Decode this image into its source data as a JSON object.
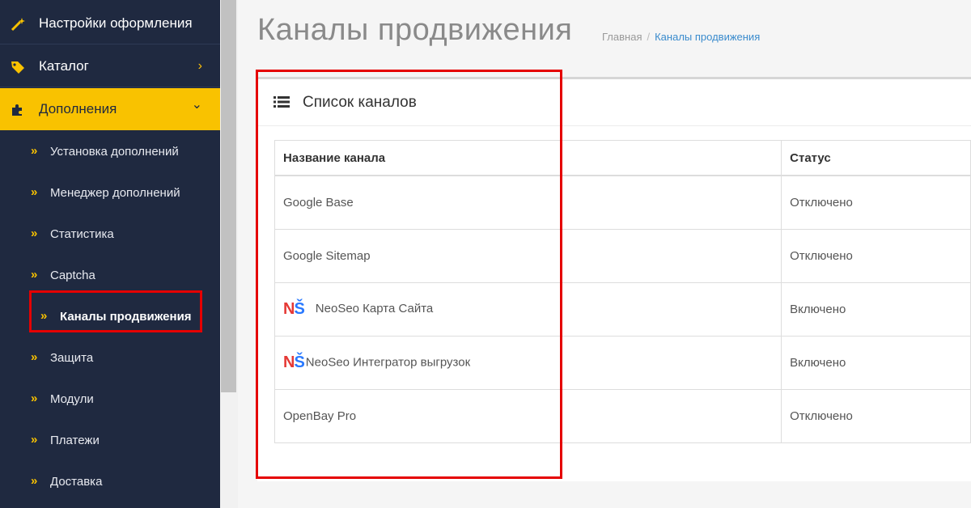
{
  "sidebar": {
    "items": [
      {
        "label": "Настройки оформления",
        "icon": "magic-wand-icon"
      },
      {
        "label": "Каталог",
        "icon": "tags-icon",
        "arrow": "›"
      },
      {
        "label": "Дополнения",
        "icon": "puzzle-icon",
        "arrow": "⌄"
      }
    ],
    "subitems": [
      {
        "label": "Установка дополнений"
      },
      {
        "label": "Менеджер дополнений"
      },
      {
        "label": "Статистика"
      },
      {
        "label": "Captcha"
      },
      {
        "label": "Каналы продвижения"
      },
      {
        "label": "Защита"
      },
      {
        "label": "Модули"
      },
      {
        "label": "Платежи"
      },
      {
        "label": "Доставка"
      }
    ],
    "chevron": "»",
    "accent": "#f9c200",
    "background": "#1f2940"
  },
  "header": {
    "title": "Каналы продвижения",
    "breadcrumb": {
      "home": "Главная",
      "separator": "/",
      "current": "Каналы продвижения"
    }
  },
  "panel": {
    "title": "Список каналов",
    "icon": "list-icon",
    "columns": [
      "Название канала",
      "Статус"
    ],
    "rows": [
      {
        "name": "Google Base",
        "status": "Отключено",
        "logo": false
      },
      {
        "name": "Google Sitemap",
        "status": "Отключено",
        "logo": false
      },
      {
        "name": "NeoSeo Карта Сайта",
        "status": "Включено",
        "logo": true
      },
      {
        "name": "NeoSeo Интегратор выгрузок",
        "status": "Включено",
        "logo": true
      },
      {
        "name": "OpenBay Pro",
        "status": "Отключено",
        "logo": false
      }
    ],
    "logo_text": {
      "n": "N",
      "s": "Š"
    }
  },
  "annotation_color": "#e50000"
}
